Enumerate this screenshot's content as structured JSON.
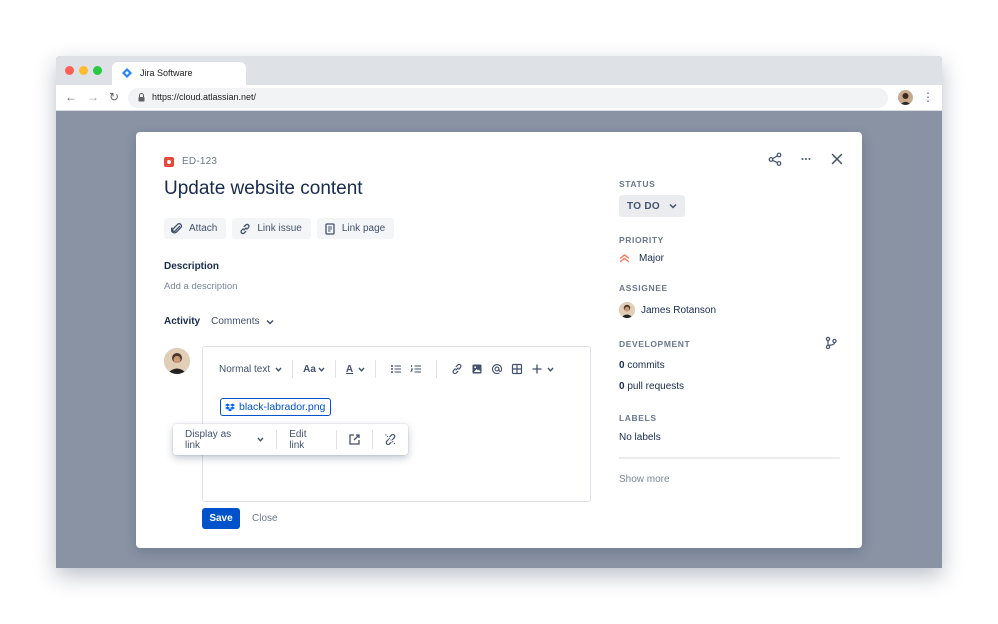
{
  "browser": {
    "tab_title": "Jira Software",
    "url": "https://cloud.atlassian.net/",
    "icons": [
      "back-arrow-icon",
      "forward-arrow-icon",
      "reload-icon",
      "lock-icon",
      "profile-avatar",
      "kebab-menu-icon"
    ]
  },
  "issue": {
    "key": "ED-123",
    "title": "Update website content",
    "actions": {
      "attach": "Attach",
      "link_issue": "Link issue",
      "link_page": "Link page"
    },
    "description_label": "Description",
    "description_placeholder": "Add a description",
    "activity_label": "Activity",
    "activity_filter": "Comments"
  },
  "editor": {
    "text_style": "Normal text",
    "font_size_label": "Aa",
    "text_color_label": "A",
    "attachment_name": "black-labrador.png",
    "link_popup": {
      "display_as": "Display as link",
      "edit_link": "Edit link"
    },
    "save_label": "Save",
    "close_label": "Close"
  },
  "sidebar": {
    "status_label": "STATUS",
    "status_value": "TO DO",
    "priority_label": "PRIORITY",
    "priority_value": "Major",
    "assignee_label": "ASSIGNEE",
    "assignee_name": "James Rotanson",
    "development_label": "DEVELOPMENT",
    "commits_count": "0",
    "commits_text": " commits",
    "prs_count": "0",
    "prs_text": " pull requests",
    "labels_label": "LABELS",
    "labels_value": "No labels",
    "show_more": "Show more"
  },
  "colors": {
    "backdrop": "#8993a4",
    "primary": "#0052cc",
    "bug": "#e5493a",
    "priority": "#ff7452"
  }
}
